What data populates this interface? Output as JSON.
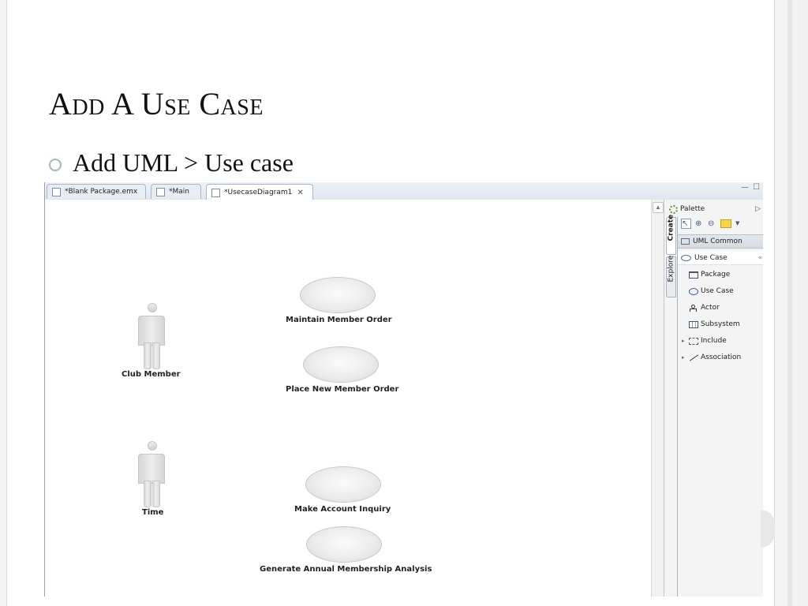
{
  "slide": {
    "title": "Add A Use Case",
    "bullet": "Add UML > Use case"
  },
  "editor": {
    "tabs": [
      {
        "label": "*Blank Package.emx",
        "active": false
      },
      {
        "label": "*Main",
        "active": false
      },
      {
        "label": "*UsecaseDiagram1",
        "active": true,
        "close": "✕"
      }
    ],
    "window_controls": {
      "minimize": "—",
      "maximize": "☐"
    }
  },
  "diagram": {
    "actors": [
      {
        "label": "Club Member"
      },
      {
        "label": "Time"
      }
    ],
    "use_cases": [
      {
        "label": "Maintain Member Order"
      },
      {
        "label": "Place New Member Order"
      },
      {
        "label": "Make Account Inquiry"
      },
      {
        "label": "Generate Annual Membership Analysis"
      }
    ]
  },
  "palette": {
    "title": "Palette",
    "collapse_arrow": "▷",
    "side_tabs": [
      "Create",
      "Explore"
    ],
    "drawers": {
      "common": "UML Common",
      "usecase": "Use Case",
      "usecase_chevron": "«"
    },
    "items": [
      {
        "label": "Package",
        "icon": "package-icon"
      },
      {
        "label": "Use Case",
        "icon": "use-case-icon"
      },
      {
        "label": "Actor",
        "icon": "actor-icon"
      },
      {
        "label": "Subsystem",
        "icon": "subsystem-icon"
      },
      {
        "label": "Include",
        "icon": "include-icon",
        "expandable": true
      },
      {
        "label": "Association",
        "icon": "association-icon",
        "expandable": true
      }
    ]
  },
  "colors": {
    "accent_bullet": "#9fb7bf",
    "tab_border": "#a9b6c8",
    "note_yellow": "#f6d34a"
  }
}
